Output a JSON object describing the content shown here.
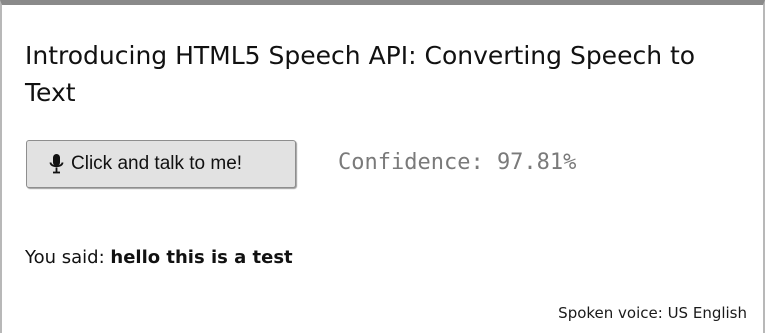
{
  "page": {
    "title": "Introducing HTML5 Speech API: Converting Speech to Text"
  },
  "talk_button": {
    "label": "Click and talk to me!",
    "icon": "microphone-icon"
  },
  "confidence": {
    "text": "Confidence: 97.81%"
  },
  "transcript": {
    "prefix": "You said:",
    "text": "hello this is a test"
  },
  "voice": {
    "text": "Spoken voice: US English"
  },
  "colors": {
    "button_background": "#e2e2e2",
    "confidence_text": "#7a7a7a",
    "frame_border": "#8a8a8a"
  }
}
